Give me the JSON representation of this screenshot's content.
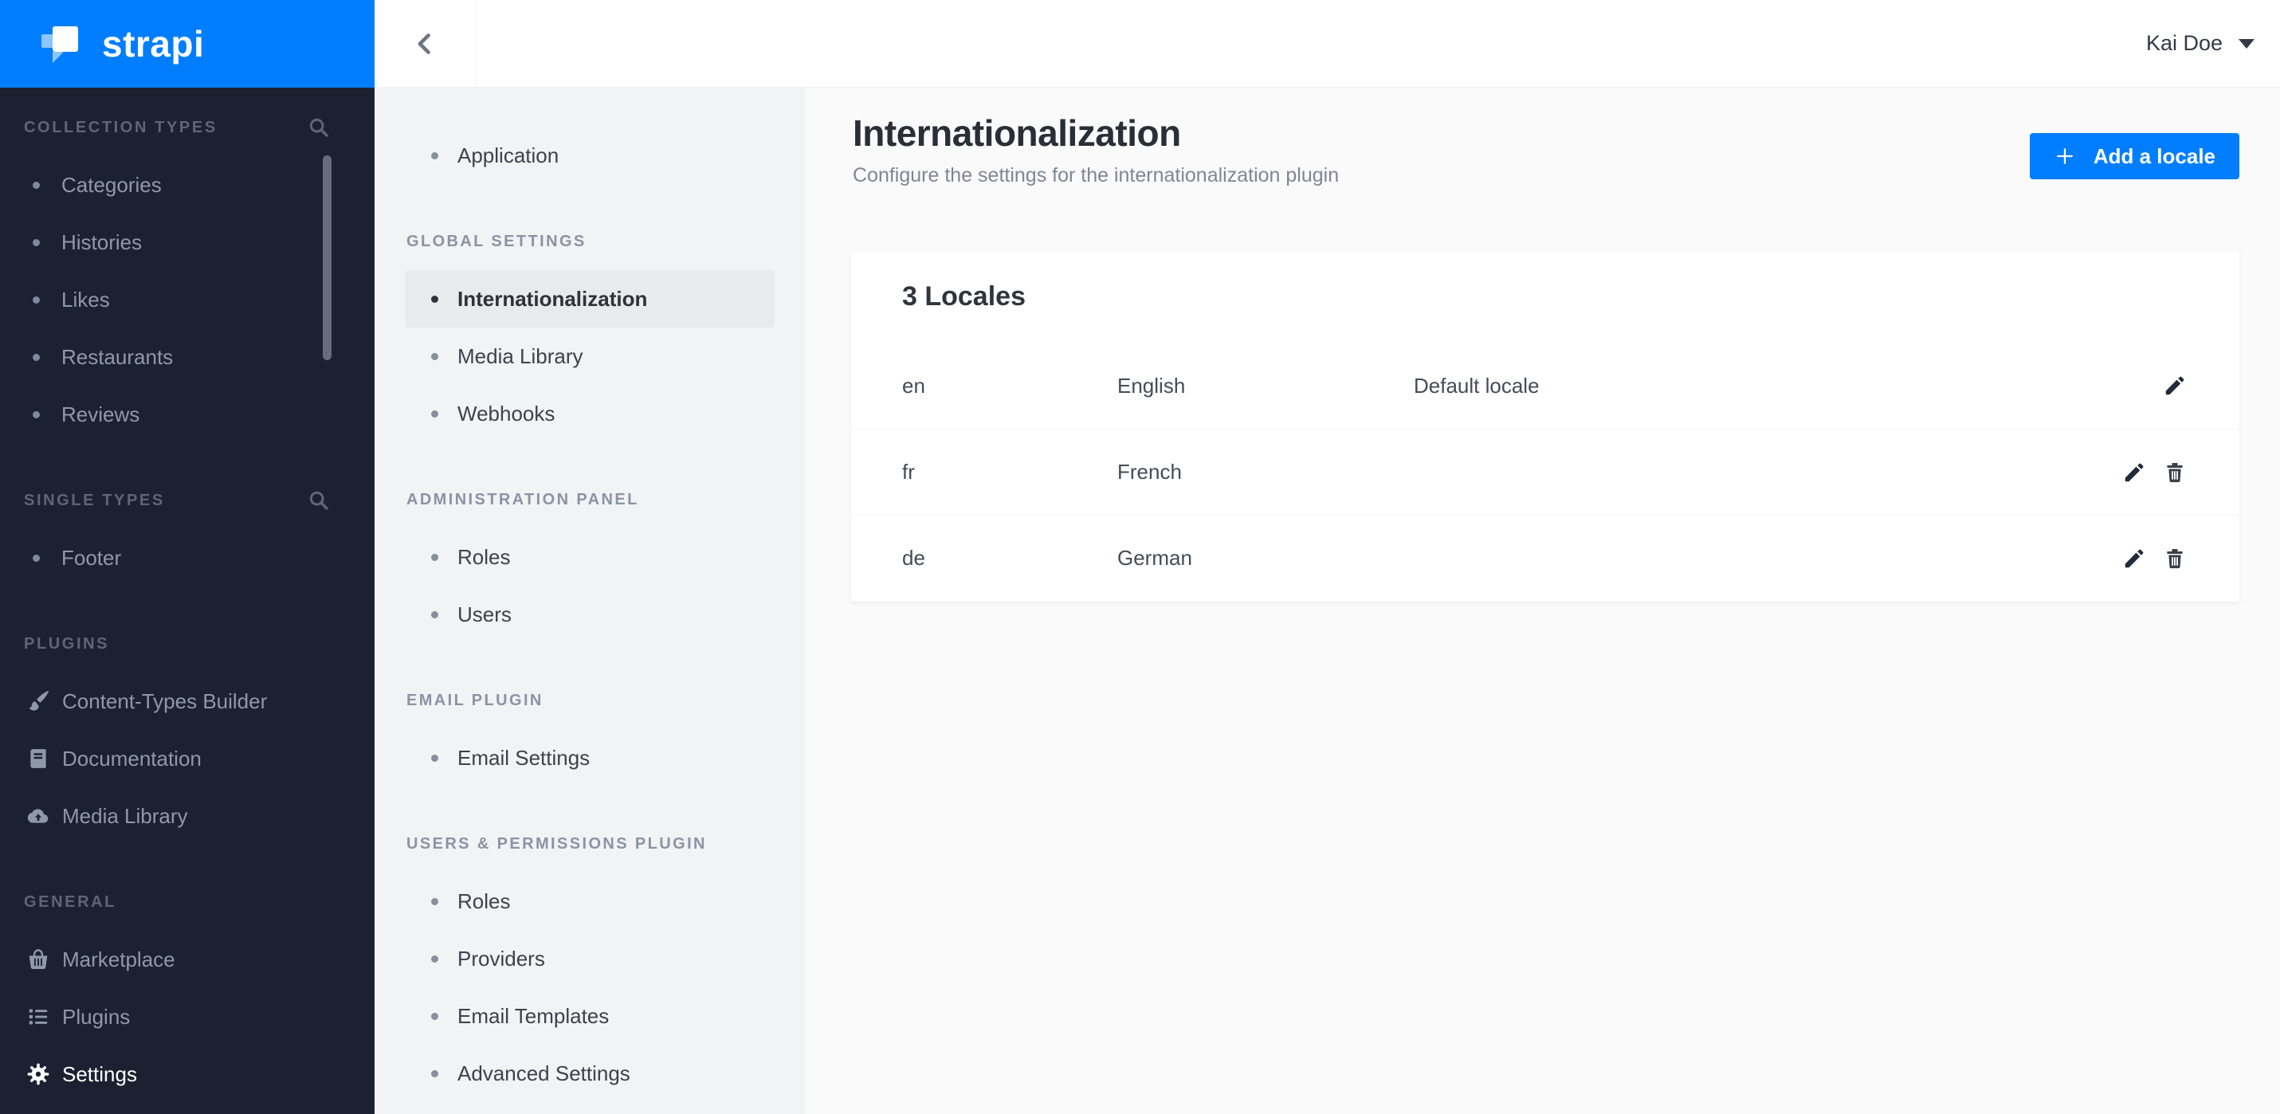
{
  "brand": {
    "logo_text": "strapi",
    "accent_blue": "#007eff",
    "sidebar_bg": "#1b2130"
  },
  "main_sidebar": {
    "sections": [
      {
        "label": "COLLECTION TYPES",
        "has_search": true,
        "items": [
          {
            "label": "Categories"
          },
          {
            "label": "Histories"
          },
          {
            "label": "Likes"
          },
          {
            "label": "Restaurants"
          },
          {
            "label": "Reviews"
          }
        ]
      },
      {
        "label": "SINGLE TYPES",
        "has_search": true,
        "items": [
          {
            "label": "Footer"
          }
        ]
      },
      {
        "label": "PLUGINS",
        "items": [
          {
            "label": "Content-Types Builder",
            "icon": "brush-icon"
          },
          {
            "label": "Documentation",
            "icon": "book-icon"
          },
          {
            "label": "Media Library",
            "icon": "cloud-upload-icon"
          }
        ]
      },
      {
        "label": "GENERAL",
        "items": [
          {
            "label": "Marketplace",
            "icon": "basket-icon"
          },
          {
            "label": "Plugins",
            "icon": "list-icon"
          },
          {
            "label": "Settings",
            "icon": "gear-icon",
            "active": true
          }
        ]
      }
    ]
  },
  "settings_nav": {
    "groups": [
      {
        "header": "",
        "items": [
          {
            "label": "Application"
          }
        ]
      },
      {
        "header": "GLOBAL SETTINGS",
        "items": [
          {
            "label": "Internationalization",
            "active": true
          },
          {
            "label": "Media Library"
          },
          {
            "label": "Webhooks"
          }
        ]
      },
      {
        "header": "ADMINISTRATION PANEL",
        "items": [
          {
            "label": "Roles"
          },
          {
            "label": "Users"
          }
        ]
      },
      {
        "header": "EMAIL PLUGIN",
        "items": [
          {
            "label": "Email Settings"
          }
        ]
      },
      {
        "header": "USERS & PERMISSIONS PLUGIN",
        "items": [
          {
            "label": "Roles"
          },
          {
            "label": "Providers"
          },
          {
            "label": "Email Templates"
          },
          {
            "label": "Advanced Settings"
          }
        ]
      }
    ]
  },
  "header": {
    "user_name": "Kai Doe"
  },
  "page": {
    "title": "Internationalization",
    "subtitle": "Configure the settings for the internationalization plugin",
    "add_button": "Add a locale"
  },
  "locales_card": {
    "title": "3 Locales",
    "rows": [
      {
        "code": "en",
        "name": "English",
        "default_label": "Default locale",
        "can_delete": false
      },
      {
        "code": "fr",
        "name": "French",
        "default_label": "",
        "can_delete": true
      },
      {
        "code": "de",
        "name": "German",
        "default_label": "",
        "can_delete": true
      }
    ]
  }
}
